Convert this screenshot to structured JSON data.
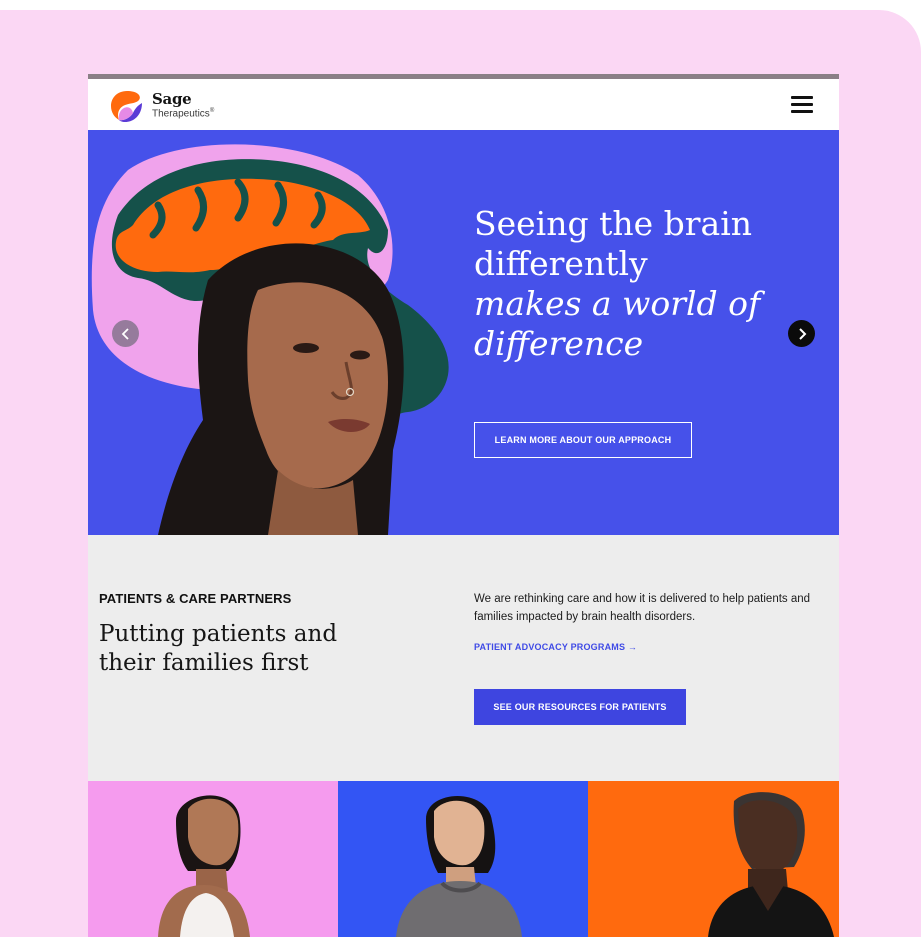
{
  "brand": {
    "name": "Sage",
    "subtitle": "Therapeutics",
    "registered_mark": "®"
  },
  "nav": {
    "menu_icon": "hamburger-menu-icon"
  },
  "hero": {
    "title_line1": "Seeing the brain",
    "title_line2": "differently",
    "title_italic_line1": "makes a world of",
    "title_italic_line2": "difference",
    "cta_label": "LEARN MORE ABOUT OUR APPROACH",
    "prev_icon": "chevron-left-icon",
    "next_icon": "chevron-right-icon"
  },
  "patients": {
    "kicker": "PATIENTS & CARE PARTNERS",
    "heading": "Putting patients and their families first",
    "body": "We are rethinking care and how it is delivered to help patients and families impacted by brain health disorders.",
    "link_label": "PATIENT ADVOCACY PROGRAMS →",
    "button_label": "SEE OUR RESOURCES FOR PATIENTS"
  },
  "colors": {
    "page_background": "#fbd7f4",
    "hero_background": "#4651ea",
    "section_background": "#ededed",
    "accent_blue": "#3e45e0",
    "brain_orange": "#ff6a0e",
    "brain_green": "#15514a",
    "brain_pink": "#f0a3ec",
    "tile_pink": "#f59bee",
    "tile_blue": "#3355f4",
    "tile_orange": "#ff6a0e"
  }
}
